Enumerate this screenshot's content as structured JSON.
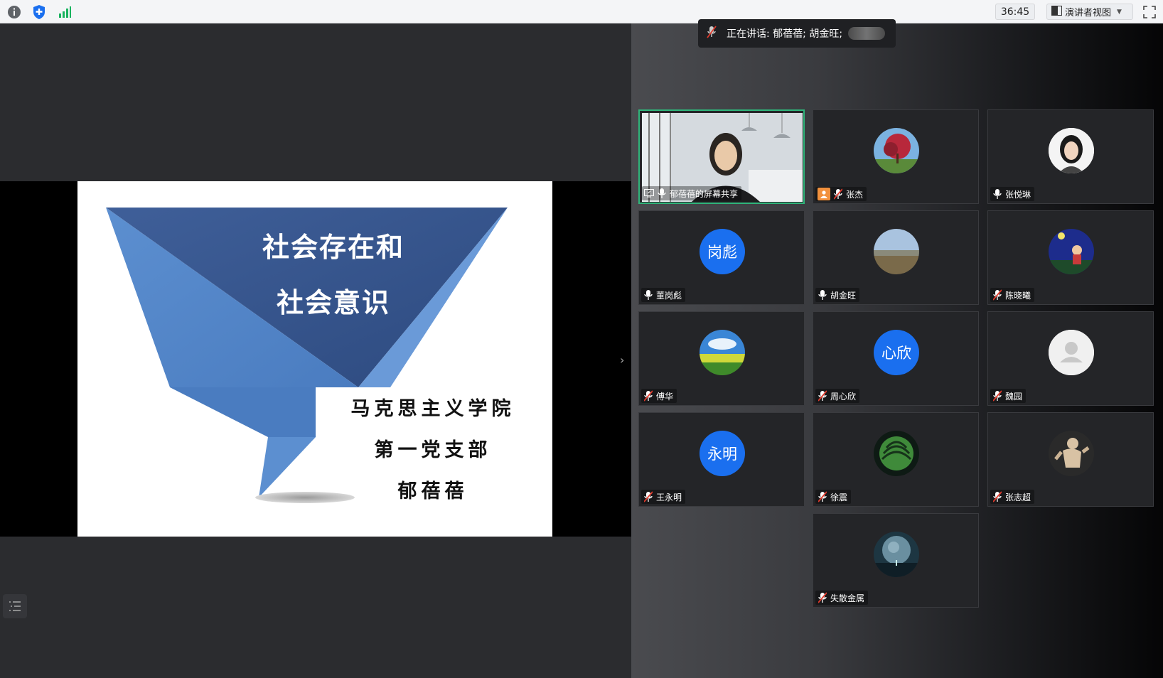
{
  "toolbar": {
    "timer": "36:45",
    "view_label": "演讲者视图",
    "icons": [
      "info-icon",
      "shield-icon",
      "signal-icon",
      "fullscreen-icon"
    ]
  },
  "slide": {
    "title_line1": "社会存在和",
    "title_line2": "社会意识",
    "org_line1": "马克思主义学院",
    "org_line2": "第一党支部",
    "presenter": "郁蓓蓓"
  },
  "speaking": {
    "text": "正在讲话: 郁蓓蓓; 胡金旺;"
  },
  "participants": [
    {
      "name": "郁蓓蓓的屏幕共享",
      "avatar_type": "camera",
      "muted": false,
      "sharing": true
    },
    {
      "name": "张杰",
      "avatar_type": "photo-tree",
      "muted": true,
      "host": true
    },
    {
      "name": "张悦琳",
      "avatar_type": "photo-person",
      "muted": false
    },
    {
      "name": "董岗彪",
      "avatar_type": "initials",
      "initials": "岗彪",
      "muted": false
    },
    {
      "name": "胡金旺",
      "avatar_type": "photo-landscape",
      "muted": false
    },
    {
      "name": "陈晓曦",
      "avatar_type": "photo-night",
      "muted": true
    },
    {
      "name": "傅华",
      "avatar_type": "photo-field",
      "muted": true
    },
    {
      "name": "周心欣",
      "avatar_type": "initials",
      "initials": "心欣",
      "muted": true
    },
    {
      "name": "魏园",
      "avatar_type": "default",
      "muted": true
    },
    {
      "name": "王永明",
      "avatar_type": "initials",
      "initials": "永明",
      "muted": true
    },
    {
      "name": "徐震",
      "avatar_type": "photo-watermelon",
      "muted": true
    },
    {
      "name": "张志超",
      "avatar_type": "photo-statue",
      "muted": true
    },
    {
      "name": "失散金属",
      "avatar_type": "photo-planet",
      "muted": true
    }
  ],
  "colors": {
    "accent_blue": "#1a6fef",
    "slide_blue": "#4a78b8",
    "active_border": "#2fb47a"
  }
}
